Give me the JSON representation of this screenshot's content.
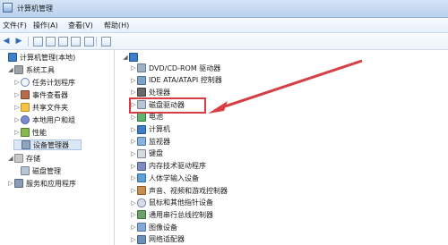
{
  "window": {
    "title": "计算机管理"
  },
  "menu": [
    {
      "label": "文件(F)"
    },
    {
      "label": "操作(A)"
    },
    {
      "label": "查看(V)"
    },
    {
      "label": "帮助(H)"
    }
  ],
  "left_tree": [
    {
      "label": "计算机管理(本地)",
      "icon": "computer-icon",
      "arrow": ""
    },
    {
      "label": "系统工具",
      "icon": "tools-icon",
      "arrow": "◢"
    },
    {
      "label": "任务计划程序",
      "icon": "clock-icon",
      "arrow": "▷"
    },
    {
      "label": "事件查看器",
      "icon": "event-icon",
      "arrow": "▷"
    },
    {
      "label": "共享文件夹",
      "icon": "folder-icon",
      "arrow": "▷"
    },
    {
      "label": "本地用户和组",
      "icon": "users-icon",
      "arrow": "▷"
    },
    {
      "label": "性能",
      "icon": "performance-icon",
      "arrow": "▷"
    },
    {
      "label": "设备管理器",
      "icon": "device-manager-icon",
      "arrow": ""
    },
    {
      "label": "存储",
      "icon": "storage-icon",
      "arrow": "◢"
    },
    {
      "label": "磁盘管理",
      "icon": "disk-icon",
      "arrow": ""
    },
    {
      "label": "服务和应用程序",
      "icon": "services-icon",
      "arrow": "▷"
    }
  ],
  "devices": [
    {
      "label": "DVD/CD-ROM 驱动器",
      "icon": "dvd-icon"
    },
    {
      "label": "IDE ATA/ATAPI 控制器",
      "icon": "ide-icon"
    },
    {
      "label": "处理器",
      "icon": "cpu-icon"
    },
    {
      "label": "磁盘驱动器",
      "icon": "disk-drive-icon"
    },
    {
      "label": "电池",
      "icon": "battery-icon"
    },
    {
      "label": "计算机",
      "icon": "computer-icon"
    },
    {
      "label": "监视器",
      "icon": "monitor-icon"
    },
    {
      "label": "键盘",
      "icon": "keyboard-icon"
    },
    {
      "label": "内存技术驱动程序",
      "icon": "memory-icon"
    },
    {
      "label": "人体学输入设备",
      "icon": "hid-icon"
    },
    {
      "label": "声音、视频和游戏控制器",
      "icon": "audio-icon"
    },
    {
      "label": "鼠标和其他指针设备",
      "icon": "mouse-icon"
    },
    {
      "label": "通用串行总线控制器",
      "icon": "usb-icon"
    },
    {
      "label": "图像设备",
      "icon": "camera-icon"
    },
    {
      "label": "网络适配器",
      "icon": "network-icon"
    }
  ],
  "colors": {
    "accent": "#d93d43",
    "selection": "#dce7f5"
  }
}
